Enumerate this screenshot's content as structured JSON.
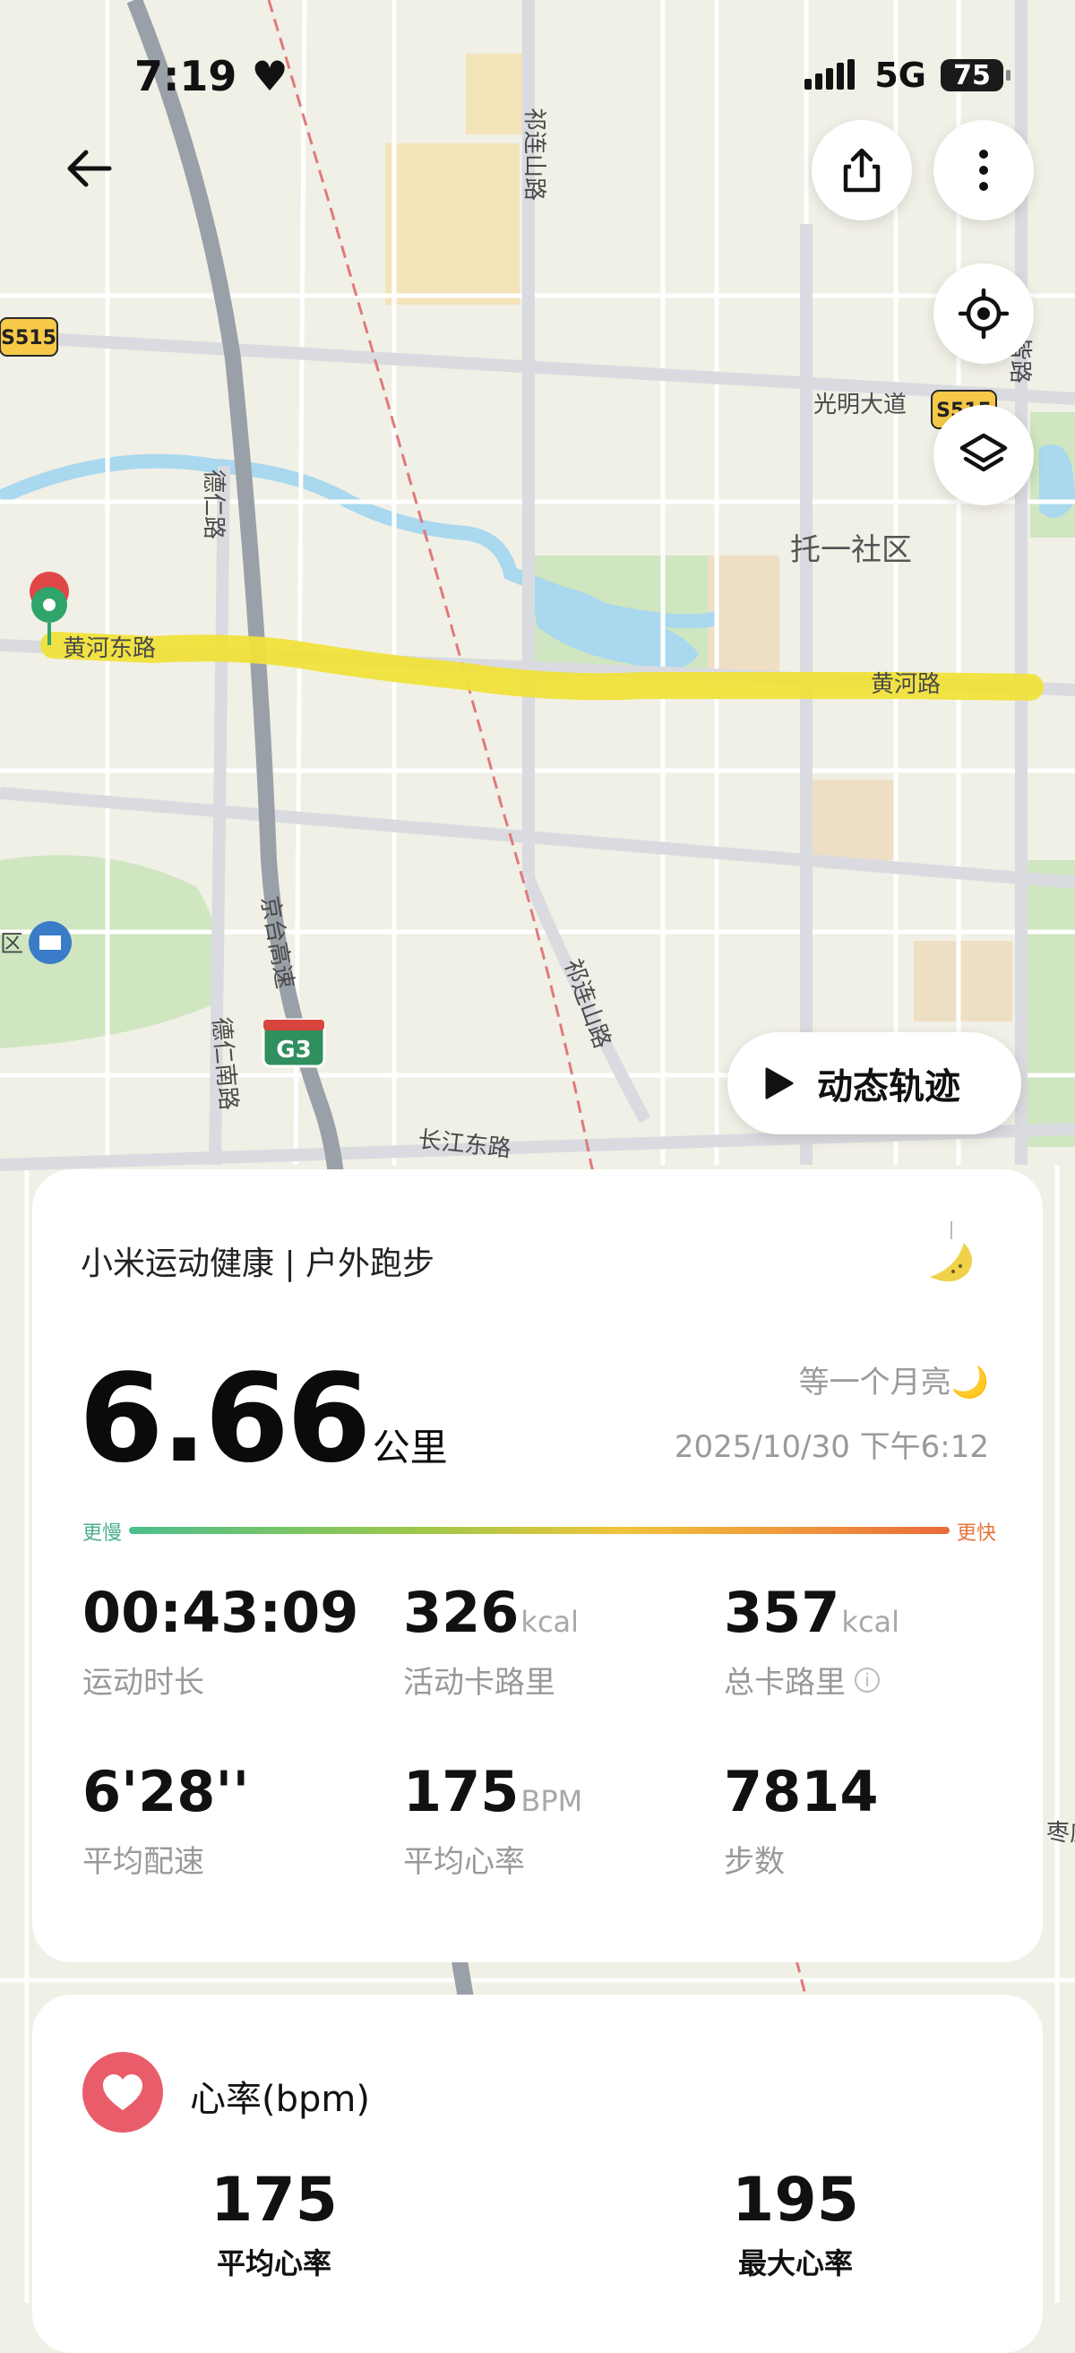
{
  "status": {
    "time": "7:19",
    "network": "5G",
    "battery": "75"
  },
  "map": {
    "labels": {
      "qilian_shan_road_n": "祁连山路",
      "s515_left": "S515",
      "s515_right": "S515",
      "guangming_avenue": "光明大道",
      "deren_road": "德仁路",
      "tuoyi_community": "托一社区",
      "huanghe_east_road": "黄河东路",
      "huanghe_road": "黄河路",
      "jingtai_expressway": "京台高速",
      "qilian_shan_road_s": "祁连山路",
      "deren_south_road": "德仁南路",
      "g3": "G3",
      "changjiang_east_road": "长江东路",
      "district_left": "区",
      "edge_right_1": "皆路",
      "edge_right_2": "枣庄"
    }
  },
  "controls": {
    "play_track_label": "动态轨迹"
  },
  "workout": {
    "source": "小米运动健康 | 户外跑步",
    "distance": "6.66",
    "distance_unit": "公里",
    "nickname": "等一个月亮🌙",
    "datetime": "2025/10/30 下午6:12",
    "pace_slow_label": "更慢",
    "pace_fast_label": "更快",
    "metrics": [
      {
        "value": "00:43:09",
        "unit": "",
        "label": "运动时长"
      },
      {
        "value": "326",
        "unit": "kcal",
        "label": "活动卡路里"
      },
      {
        "value": "357",
        "unit": "kcal",
        "label": "总卡路里"
      },
      {
        "value": "6'28''",
        "unit": "",
        "label": "平均配速"
      },
      {
        "value": "175",
        "unit": "BPM",
        "label": "平均心率"
      },
      {
        "value": "7814",
        "unit": "",
        "label": "步数"
      }
    ]
  },
  "heart_rate": {
    "title": "心率(bpm)",
    "avg_value": "175",
    "avg_label": "平均心率",
    "max_value": "195",
    "max_label": "最大心率"
  }
}
